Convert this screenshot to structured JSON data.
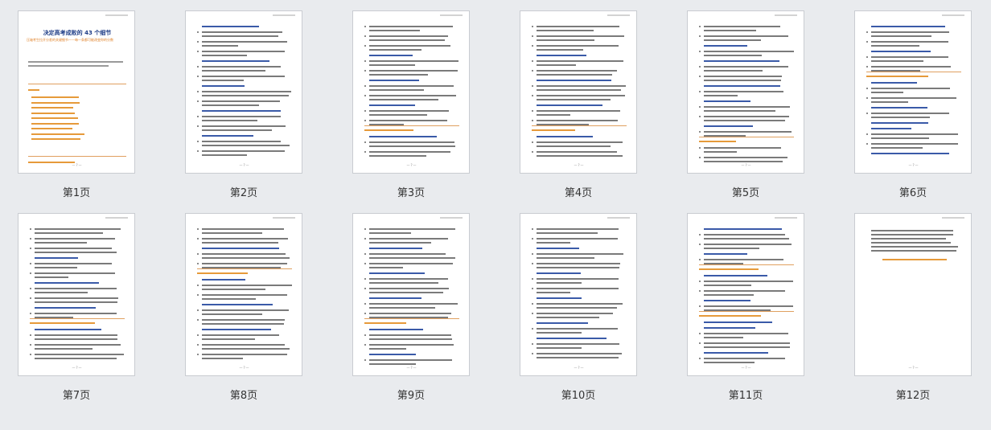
{
  "cover": {
    "title": "决定高考成败的 43 个细节",
    "subtitle": "压轴考生拉开分差的关键细节——每一条都可能改变你的分数"
  },
  "pages": [
    {
      "label": "第1页"
    },
    {
      "label": "第2页"
    },
    {
      "label": "第3页"
    },
    {
      "label": "第4页"
    },
    {
      "label": "第5页"
    },
    {
      "label": "第6页"
    },
    {
      "label": "第7页"
    },
    {
      "label": "第8页"
    },
    {
      "label": "第9页"
    },
    {
      "label": "第10页"
    },
    {
      "label": "第11页"
    },
    {
      "label": "第12页"
    }
  ],
  "footer_mark": "—?—",
  "colors": {
    "background": "#e9ebee",
    "page": "#ffffff",
    "heading_blue": "#3a5aa8",
    "heading_orange": "#e69a3a",
    "body_text": "#7a7a7a"
  }
}
